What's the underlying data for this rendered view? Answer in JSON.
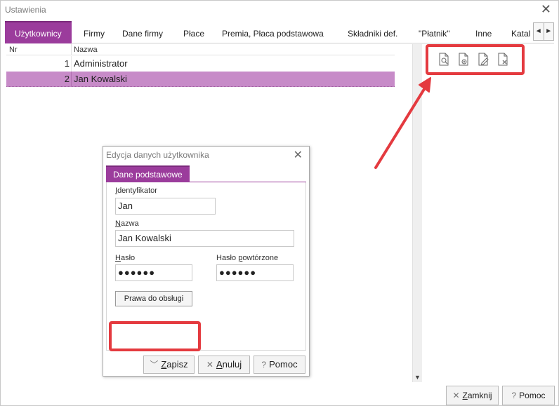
{
  "window": {
    "title": "Ustawienia",
    "close_glyph": "✕"
  },
  "tabs": [
    {
      "label": "Użytkownicy",
      "active": true
    },
    {
      "label": "Firmy"
    },
    {
      "label": "Dane firmy"
    },
    {
      "label": "Płace"
    },
    {
      "label": "Premia, Płaca podstawowa"
    },
    {
      "label": "Składniki def."
    },
    {
      "label": "\"Płatnik\""
    },
    {
      "label": "Inne"
    },
    {
      "label": "Katal"
    }
  ],
  "tab_scroll": {
    "left": "◄",
    "right": "►"
  },
  "grid": {
    "columns": {
      "nr": "Nr",
      "name": "Nazwa"
    },
    "rows": [
      {
        "nr": "1",
        "name": "Administrator"
      },
      {
        "nr": "2",
        "name": "Jan Kowalski",
        "selected": true
      }
    ]
  },
  "scroll_down_glyph": "▼",
  "toolbar_icons": [
    "preview-document-icon",
    "add-document-icon",
    "edit-document-icon",
    "delete-document-icon"
  ],
  "dialog": {
    "title": "Edycja danych użytkownika",
    "close_glyph": "✕",
    "tab": "Dane podstawowe",
    "identifier_label_u": "I",
    "identifier_label_rest": "dentyfikator",
    "identifier_value": "Jan",
    "name_label_u": "N",
    "name_label_rest": "azwa",
    "name_value": "Jan Kowalski",
    "password_label_u": "H",
    "password_label_rest": "asło",
    "password_value": "●●●●●●",
    "password_repeat_label_pre": "Hasło ",
    "password_repeat_label_u": "p",
    "password_repeat_label_rest": "owtórzone",
    "password_repeat_value": "●●●●●●",
    "rights_button": "Prawa do obsługi",
    "save_icon": "﹀",
    "save_u": "Z",
    "save_rest": "apisz",
    "cancel_icon": "✕",
    "cancel_u": "A",
    "cancel_rest": "nuluj",
    "help_icon": "?",
    "help_label": "Pomoc"
  },
  "footer": {
    "close_icon": "✕",
    "close_u": "Z",
    "close_rest": "amknij",
    "help_icon": "?",
    "help_label": "Pomoc"
  },
  "colors": {
    "accent": "#9b3c9c",
    "selection": "#c78bc8",
    "highlight": "#e43a3f"
  }
}
